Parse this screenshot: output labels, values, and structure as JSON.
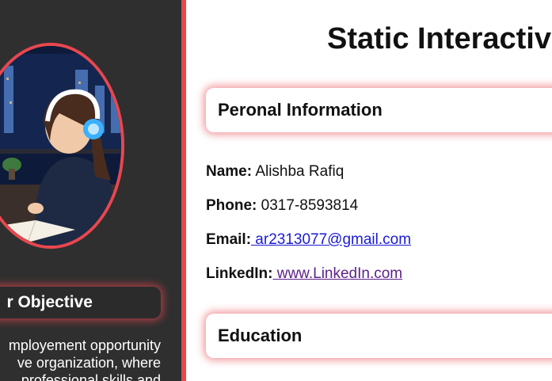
{
  "page": {
    "title": "Static Interactive"
  },
  "sidebar": {
    "objective_heading": "r Objective",
    "objective_lines": [
      "mployement opportunity",
      "ve organization, where",
      "professional skills and"
    ]
  },
  "sections": {
    "personal": "Peronal Information",
    "education": "Education"
  },
  "personal_info": {
    "name_label": "Name:",
    "name_value": "Alishba Rafiq",
    "phone_label": "Phone:",
    "phone_value": "0317-8593814",
    "email_label": "Email:",
    "email_value": " ar2313077@gmail.com",
    "linkedin_label": "LinkedIn:",
    "linkedin_value": " www.LinkedIn.com"
  },
  "colors": {
    "accent": "#e8474f",
    "sidebar_bg": "#2f2f2f"
  }
}
